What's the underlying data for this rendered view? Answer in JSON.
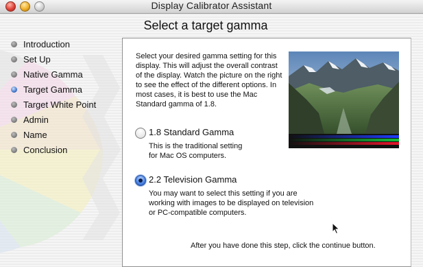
{
  "window": {
    "title": "Display Calibrator Assistant",
    "controls": [
      "close",
      "minimize",
      "zoom"
    ]
  },
  "page": {
    "heading": "Select a target gamma"
  },
  "steps": [
    {
      "label": "Introduction",
      "active": false
    },
    {
      "label": "Set Up",
      "active": false
    },
    {
      "label": "Native Gamma",
      "active": false
    },
    {
      "label": "Target Gamma",
      "active": true
    },
    {
      "label": "Target White Point",
      "active": false
    },
    {
      "label": "Admin",
      "active": false
    },
    {
      "label": "Name",
      "active": false
    },
    {
      "label": "Conclusion",
      "active": false
    }
  ],
  "panel": {
    "intro": "Select your desired gamma setting for this display. This will adjust the overall contrast of the display.  Watch the picture on the right to see the effect of the different options.  In most cases, it is best to use the Mac Standard gamma of 1.8.",
    "preview": {
      "image": "mountain-landscape",
      "bars": [
        "#1e3cff",
        "#14c03c",
        "#e8152a"
      ]
    },
    "options": [
      {
        "title": "1.8 Standard Gamma",
        "description": "This is the traditional setting for Mac OS computers.",
        "selected": false
      },
      {
        "title": "2.2 Television Gamma",
        "description": "You may want to select this setting if you are working with images to be displayed on television or PC-compatible computers.",
        "selected": true
      }
    ],
    "footer": "After you have done this step, click the continue button."
  }
}
